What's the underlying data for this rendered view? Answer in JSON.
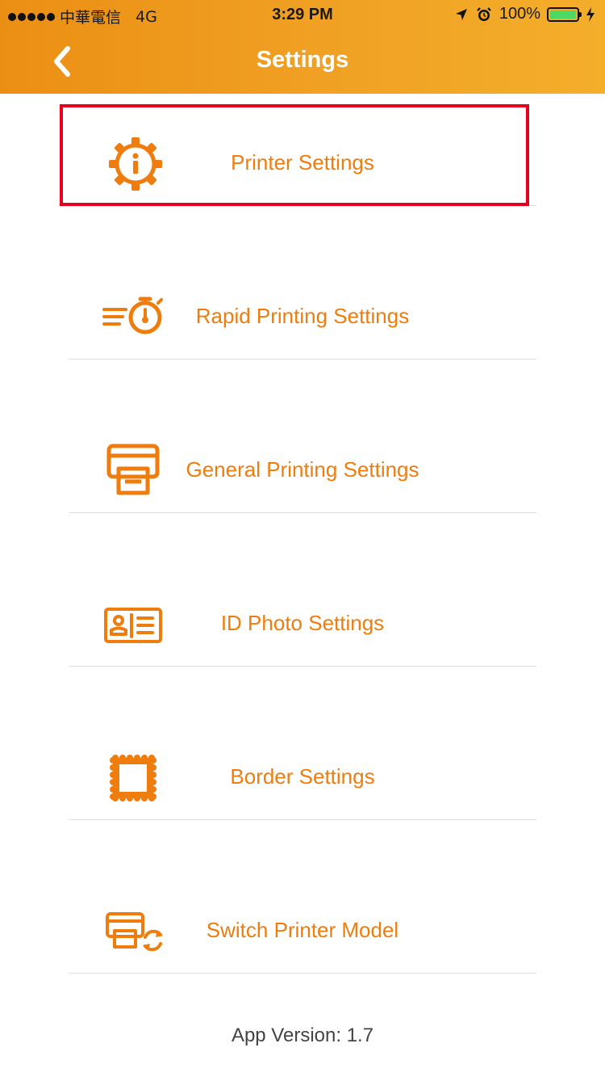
{
  "status_bar": {
    "carrier": "中華電信",
    "network": "4G",
    "time": "3:29 PM",
    "battery": "100%"
  },
  "nav": {
    "title": "Settings",
    "back_icon": "chevron-left-icon"
  },
  "menu": {
    "items": [
      {
        "label": "Printer Settings",
        "icon": "gear-info-icon"
      },
      {
        "label": "Rapid Printing Settings",
        "icon": "stopwatch-icon"
      },
      {
        "label": "General Printing Settings",
        "icon": "printer-icon"
      },
      {
        "label": "ID Photo Settings",
        "icon": "id-card-icon"
      },
      {
        "label": "Border Settings",
        "icon": "stamp-border-icon"
      },
      {
        "label": "Switch Printer Model",
        "icon": "printer-switch-icon"
      }
    ]
  },
  "footer": {
    "app_version": "App Version:  1.7"
  },
  "colors": {
    "header_start": "#eb8f14",
    "header_end": "#f4ae2a",
    "accent": "#ee7d0e",
    "highlight": "#e8001c"
  }
}
